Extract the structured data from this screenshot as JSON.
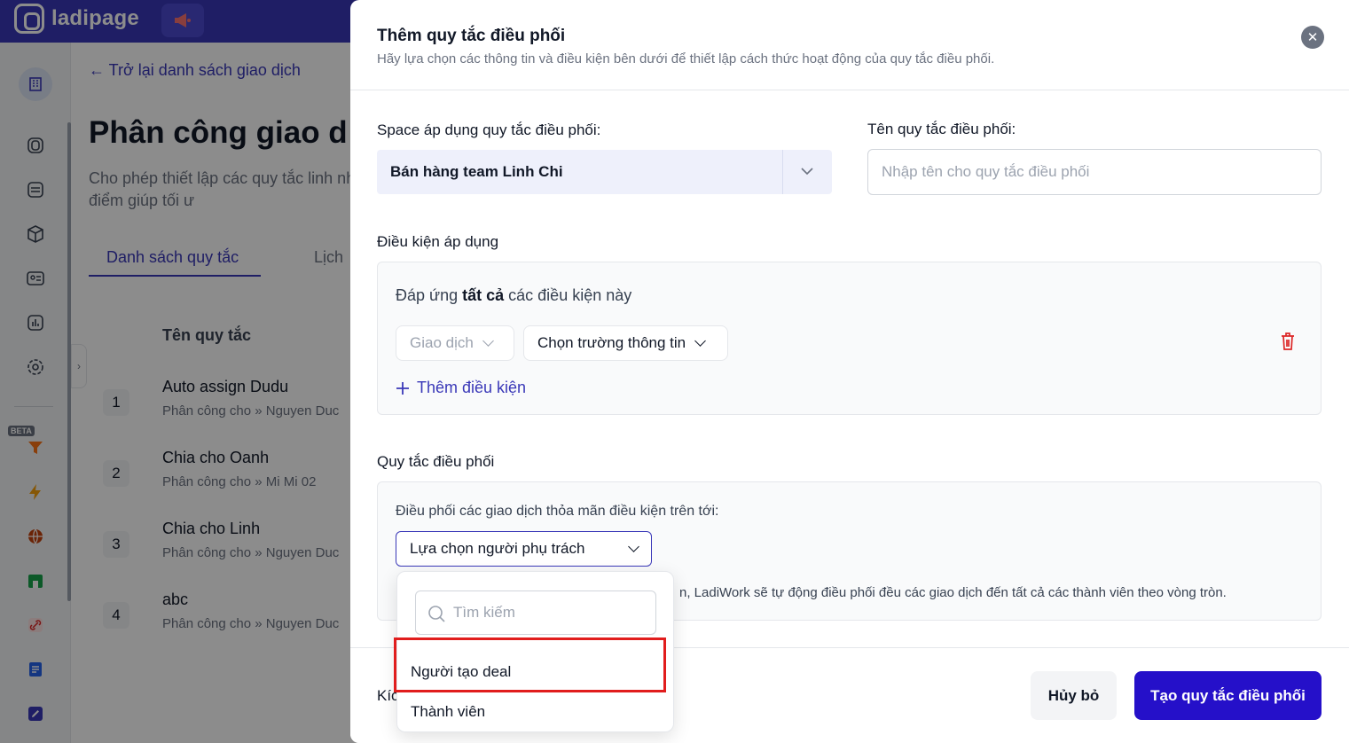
{
  "app": {
    "logo_text": "ladipage"
  },
  "page": {
    "back_link": "← Trở lại danh sách giao dịch",
    "title": "Phân công giao d",
    "description": "Cho phép thiết lập các quy tắc linh nhân viên, đúng thời điểm giúp tối ư",
    "tabs": [
      "Danh sách quy tắc",
      "Lịch"
    ],
    "column_header": "Tên quy tắc",
    "rules": [
      {
        "index": "1",
        "name": "Auto assign Dudu",
        "assigned": "Phân công cho » Nguyen Duc"
      },
      {
        "index": "2",
        "name": "Chia cho Oanh",
        "assigned": "Phân công cho » Mi Mi 02"
      },
      {
        "index": "3",
        "name": "Chia cho Linh",
        "assigned": "Phân công cho » Nguyen Duc"
      },
      {
        "index": "4",
        "name": "abc",
        "assigned": "Phân công cho » Nguyen Duc"
      }
    ]
  },
  "sidebar": {
    "beta_label": "BETA",
    "icons": [
      "building-icon",
      "layers-icon",
      "inbox-icon",
      "box-icon",
      "contact-card-icon",
      "chart-icon",
      "settings-icon",
      "funnel-icon",
      "lightning-icon",
      "globe-icon",
      "store-icon",
      "link-icon",
      "document-icon",
      "edit-icon"
    ]
  },
  "drawer": {
    "title": "Thêm quy tắc điều phối",
    "subtitle": "Hãy lựa chọn các thông tin và điều kiện bên dưới để thiết lập cách thức hoạt động của quy tắc điều phối.",
    "space_label": "Space áp dụng quy tắc điều phối:",
    "space_value": "Bán hàng team Linh Chi",
    "name_label": "Tên quy tắc điều phối:",
    "name_placeholder": "Nhập tên cho quy tắc điều phối",
    "conditions_label": "Điều kiện áp dụng",
    "conditions_prefix": "Đáp ứng",
    "conditions_bold": "tất cả",
    "conditions_suffix": "các điều kiện này",
    "condition_object": "Giao dịch",
    "condition_field": "Chọn trường thông tin",
    "add_condition": "Thêm điều kiện",
    "rule_label": "Quy tắc điều phối",
    "rule_text": "Điều phối các giao dịch thỏa mãn điều kiện trên tới:",
    "assignee_select": "Lựa chọn người phụ trách",
    "rule_note": "n, LadiWork sẽ tự động điều phối đều các giao dịch đến tất cả các thành viên theo vòng tròn.",
    "footer_label": "Kíc",
    "cancel": "Hủy bỏ",
    "create": "Tạo quy tắc điều phối"
  },
  "dropdown": {
    "search_placeholder": "Tìm kiếm",
    "options": [
      "Người tạo deal",
      "Thành viên"
    ]
  },
  "colors": {
    "brand": "#3a38b8",
    "primary_button": "#2510c9",
    "danger": "#dc2626",
    "highlight": "#e11d1d"
  }
}
